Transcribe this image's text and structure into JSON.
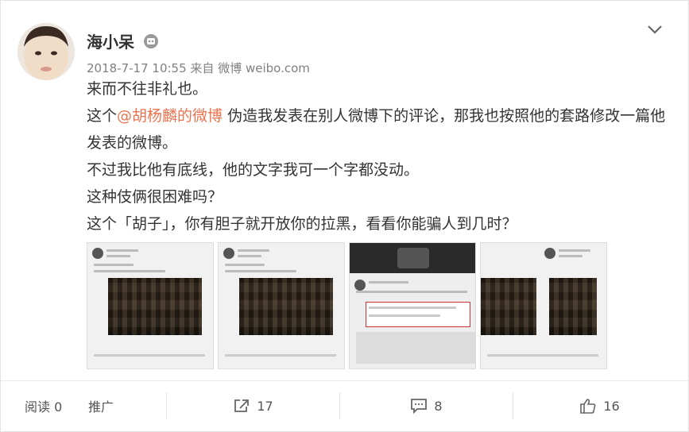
{
  "post": {
    "author_name": "海小呆",
    "timestamp": "2018-7-17 10:55",
    "source_prefix": "来自",
    "source": "微博 weibo.com",
    "lines": {
      "l1": "来而不往非礼也。",
      "l2_pre": "这个",
      "l2_mention": "@胡杨麟的微博",
      "l2_post": " 伪造我发表在别人微博下的评论，那我也按照他的套路修改一篇他发表的微博。",
      "l3": "不过我比他有底线，他的文字我可一个字都没动。",
      "l4": "这种伎俩很困难吗？",
      "l5": "这个「胡子」，你有胆子就开放你的拉黑，看看你能骗人到几时？"
    }
  },
  "actions": {
    "read_label": "阅读 0",
    "promote_label": "推广",
    "forward_count": "17",
    "comment_count": "8",
    "like_count": "16"
  },
  "colors": {
    "mention": "#eb7350",
    "meta": "#808080"
  },
  "icons": [
    "robot-badge-icon",
    "chevron-down-icon",
    "share-icon",
    "comment-icon",
    "thumbs-up-icon"
  ]
}
